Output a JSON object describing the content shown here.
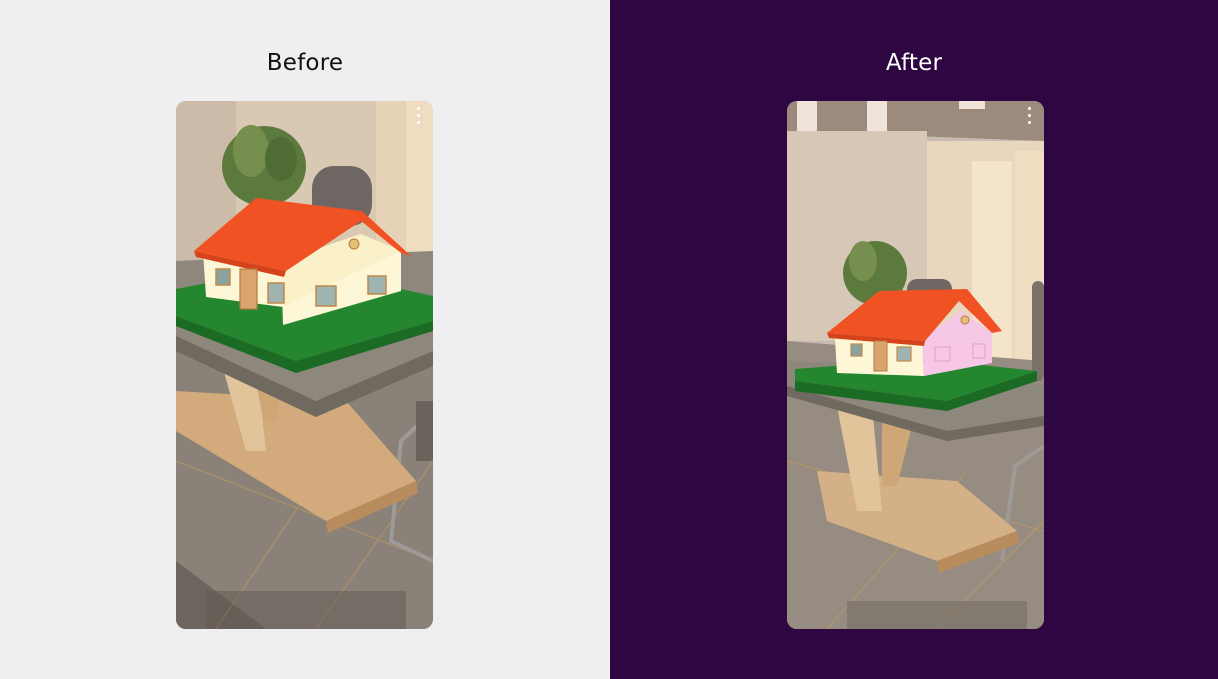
{
  "panels": {
    "before": {
      "title": "Before",
      "background": "#efeff1",
      "title_color": "#111111"
    },
    "after": {
      "title": "After",
      "background": "#2e0742",
      "title_color": "#ffffff"
    }
  },
  "scene": {
    "roof_color": "#f05223",
    "wall_color": "#fdf7d8",
    "lawn_color": "#24862f",
    "after_highlight_wall_color": "#f7c7e6"
  },
  "icons": {
    "menu": "more-vertical-icon"
  }
}
